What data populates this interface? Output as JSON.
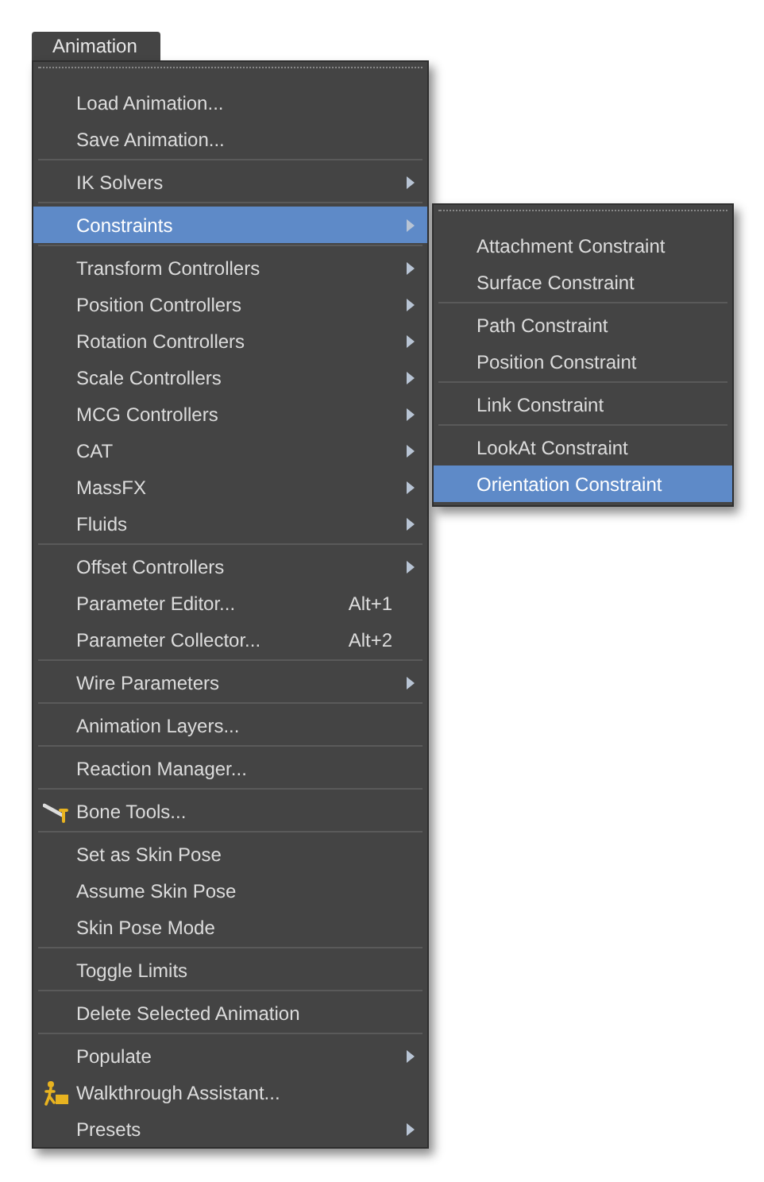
{
  "menu_title": "Animation",
  "menu": {
    "groups": [
      [
        {
          "label": "Load Animation...",
          "submenu": false,
          "selected": false
        },
        {
          "label": "Save Animation...",
          "submenu": false,
          "selected": false
        }
      ],
      [
        {
          "label": "IK Solvers",
          "submenu": true,
          "selected": false
        }
      ],
      [
        {
          "label": "Constraints",
          "submenu": true,
          "selected": true
        }
      ],
      [
        {
          "label": "Transform Controllers",
          "submenu": true,
          "selected": false
        },
        {
          "label": "Position Controllers",
          "submenu": true,
          "selected": false
        },
        {
          "label": "Rotation Controllers",
          "submenu": true,
          "selected": false
        },
        {
          "label": "Scale Controllers",
          "submenu": true,
          "selected": false
        },
        {
          "label": "MCG Controllers",
          "submenu": true,
          "selected": false
        },
        {
          "label": "CAT",
          "submenu": true,
          "selected": false
        },
        {
          "label": "MassFX",
          "submenu": true,
          "selected": false
        },
        {
          "label": "Fluids",
          "submenu": true,
          "selected": false
        }
      ],
      [
        {
          "label": "Offset Controllers",
          "submenu": true,
          "selected": false
        },
        {
          "label": "Parameter Editor...",
          "shortcut": "Alt+1",
          "submenu": false,
          "selected": false
        },
        {
          "label": "Parameter Collector...",
          "shortcut": "Alt+2",
          "submenu": false,
          "selected": false
        }
      ],
      [
        {
          "label": "Wire Parameters",
          "submenu": true,
          "selected": false
        }
      ],
      [
        {
          "label": "Animation Layers...",
          "submenu": false,
          "selected": false
        }
      ],
      [
        {
          "label": "Reaction Manager...",
          "submenu": false,
          "selected": false
        }
      ],
      [
        {
          "label": "Bone Tools...",
          "kind": "bone",
          "submenu": false,
          "selected": false
        }
      ],
      [
        {
          "label": "Set as Skin Pose",
          "submenu": false,
          "selected": false
        },
        {
          "label": "Assume Skin Pose",
          "submenu": false,
          "selected": false
        },
        {
          "label": "Skin Pose Mode",
          "submenu": false,
          "selected": false
        }
      ],
      [
        {
          "label": "Toggle Limits",
          "submenu": false,
          "selected": false
        }
      ],
      [
        {
          "label": "Delete Selected Animation",
          "submenu": false,
          "selected": false
        }
      ],
      [
        {
          "label": "Populate",
          "submenu": true,
          "selected": false
        },
        {
          "label": "Walkthrough Assistant...",
          "kind": "walker",
          "submenu": false,
          "selected": false
        },
        {
          "label": "Presets",
          "submenu": true,
          "selected": false
        }
      ]
    ]
  },
  "submenu": {
    "groups": [
      [
        {
          "label": "Attachment Constraint",
          "selected": false
        },
        {
          "label": "Surface Constraint",
          "selected": false
        }
      ],
      [
        {
          "label": "Path Constraint",
          "selected": false
        },
        {
          "label": "Position Constraint",
          "selected": false
        }
      ],
      [
        {
          "label": "Link Constraint",
          "selected": false
        }
      ],
      [
        {
          "label": "LookAt Constraint",
          "selected": false
        },
        {
          "label": "Orientation Constraint",
          "selected": true
        }
      ]
    ]
  }
}
